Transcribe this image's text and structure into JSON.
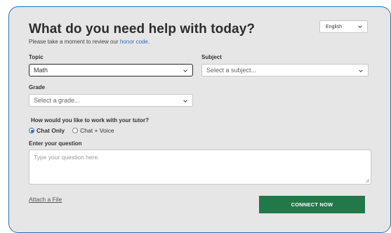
{
  "heading": {
    "title": "What do you need help with today?",
    "subtitle_prefix": "Please take a moment to review our ",
    "honor_code_link": "honor code",
    "subtitle_suffix": "."
  },
  "language": {
    "selected": "English"
  },
  "topic": {
    "label": "Topic",
    "selected": "Math"
  },
  "subject": {
    "label": "Subject",
    "placeholder": "Select a subject..."
  },
  "grade": {
    "label": "Grade",
    "placeholder": "Select a grade..."
  },
  "work_mode": {
    "question": "How would you like to work with your tutor?",
    "options": [
      {
        "label": "Chat Only",
        "checked": true
      },
      {
        "label": "Chat + Voice",
        "checked": false
      }
    ]
  },
  "question": {
    "label": "Enter your question",
    "placeholder": "Type your question here."
  },
  "actions": {
    "attach_label": "Attach a File",
    "connect_label": "CONNECT NOW"
  },
  "colors": {
    "accent_blue": "#2e6fbf",
    "button_green": "#23784a",
    "card_bg": "#e6e6e6",
    "card_border": "#2f6fb3"
  }
}
